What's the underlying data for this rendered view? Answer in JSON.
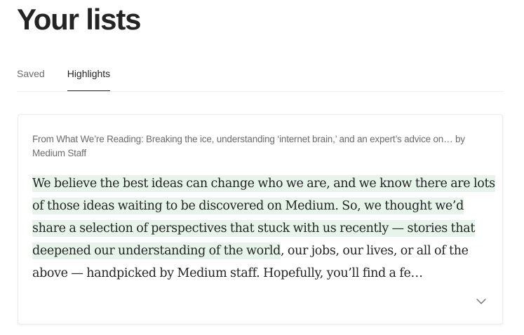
{
  "page": {
    "title": "Your lists"
  },
  "tabs": [
    {
      "label": "Saved",
      "active": false
    },
    {
      "label": "Highlights",
      "active": true
    }
  ],
  "highlight_card": {
    "source": "From What We’re Reading: Breaking the ice, understanding ‘internet brain,’ and an expert’s advice on… by Medium Staff",
    "highlighted_text": "We believe the best ideas can change who we are, and we know there are lots of those ideas waiting to be discovered on Medium. So, we thought we’d share a selection of perspectives that stuck with us recently — stories that deepened our understanding of the world",
    "remaining_text": ", our jobs, our lives, or all of the above — handpicked by Medium staff. Hopefully, you’ll find a fe…",
    "expand_icon": "chevron-down-icon"
  },
  "colors": {
    "highlight": "#e6f4ea",
    "text_primary": "#242424",
    "text_secondary": "#6b6b6b",
    "divider": "#f2f2f2"
  }
}
